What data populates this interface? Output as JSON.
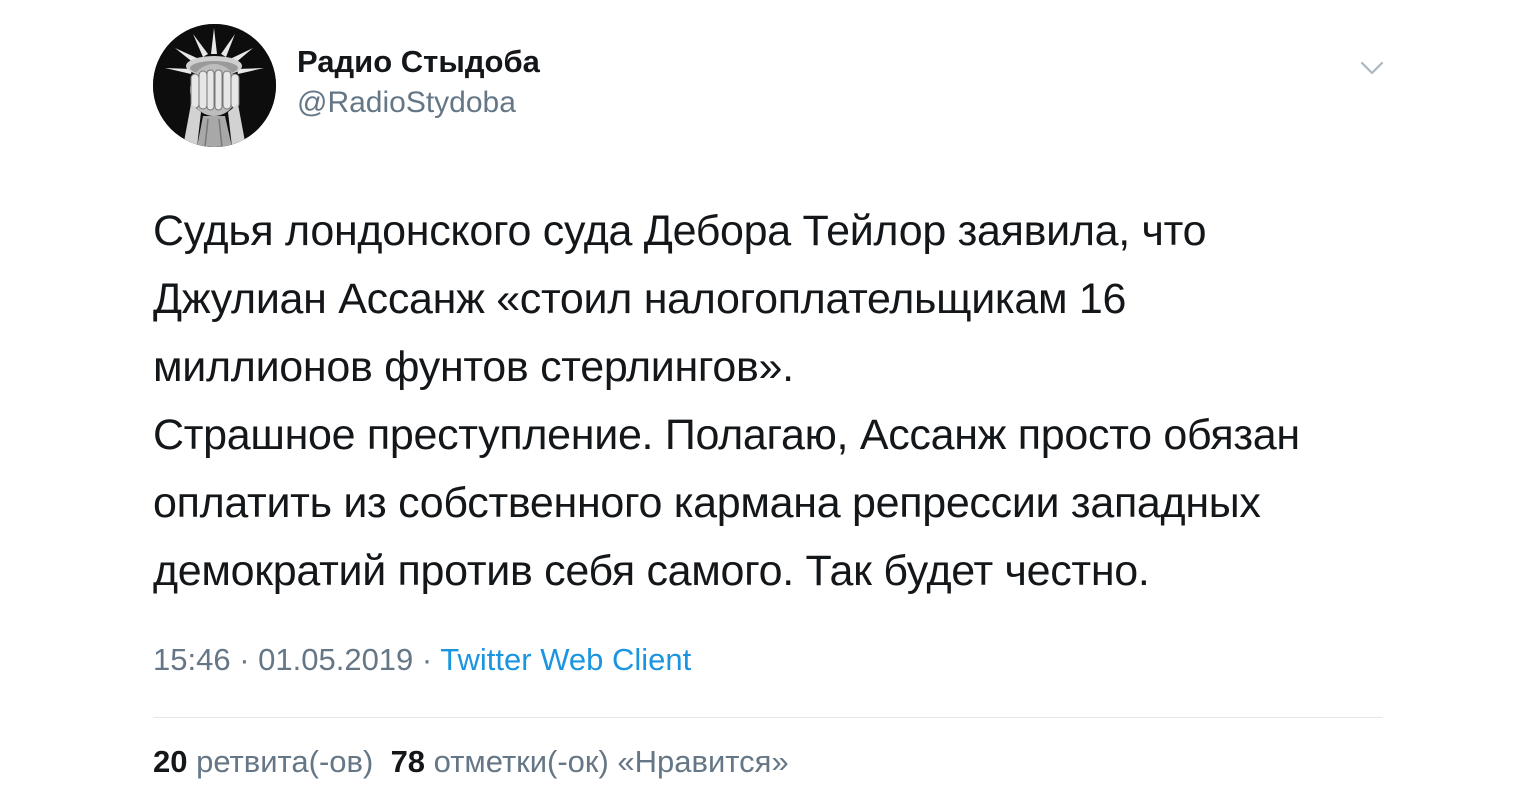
{
  "tweet": {
    "author": {
      "display_name": "Радио Стыдоба",
      "handle": "@RadioStydoba",
      "avatar_icon": "covered-face-statue-avatar"
    },
    "menu_icon": "chevron-down-icon",
    "text": "Судья лондонского суда Дебора Тейлор заявила, что\nДжулиан Ассанж «стоил налогоплательщикам 16\nмиллионов фунтов стерлингов».\nСтрашное преступление. Полагаю, Ассанж просто обязан\nоплатить из собственного кармана репрессии западных\nдемократий против себя самого. Так будет честно.",
    "time": "15:46",
    "separator": " · ",
    "date": "01.05.2019",
    "source": "Twitter Web Client",
    "stats": {
      "retweets_count": "20",
      "retweets_label": "ретвита(-ов)",
      "likes_count": "78",
      "likes_label": "отметки(-ок) «Нравится»"
    }
  },
  "colors": {
    "text": "#14171a",
    "secondary": "#657786",
    "link": "#1b95e0",
    "divider": "#e1e8ed"
  }
}
